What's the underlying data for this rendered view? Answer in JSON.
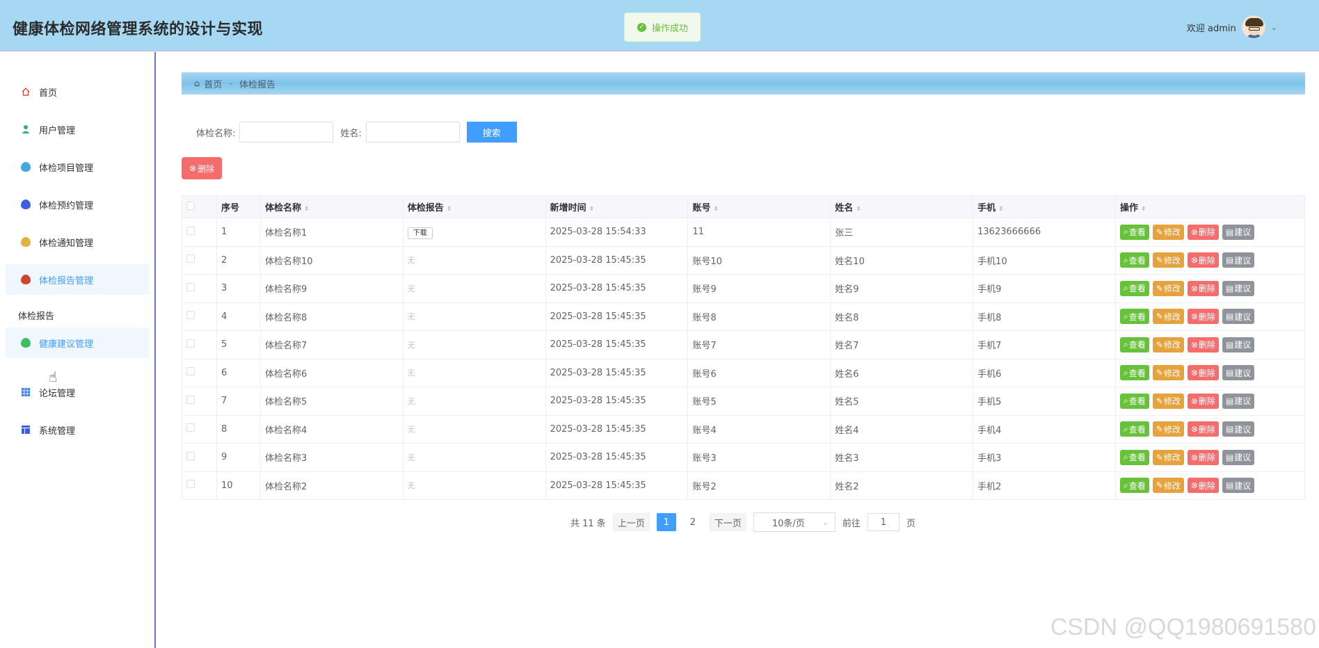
{
  "header": {
    "title": "健康体检网络管理系统的设计与实现",
    "toast": "操作成功",
    "welcome": "欢迎 admin"
  },
  "sidebar": {
    "items": [
      {
        "label": "首页",
        "icon": "home-icon",
        "color": "#e0473c"
      },
      {
        "label": "用户管理",
        "icon": "user-icon",
        "color": "#2fb36d"
      },
      {
        "label": "体检项目管理",
        "icon": "drop-icon",
        "color": "#3fa9e0"
      },
      {
        "label": "体检预约管理",
        "icon": "drop-icon",
        "color": "#3f5ee0"
      },
      {
        "label": "体检通知管理",
        "icon": "drop-icon",
        "color": "#e0b33f"
      },
      {
        "label": "体检报告管理",
        "icon": "drop-icon",
        "color": "#d0452f"
      },
      {
        "label": "健康建议管理",
        "icon": "drop-icon",
        "color": "#3ebf5f"
      },
      {
        "label": "论坛管理",
        "icon": "grid-icon",
        "color": "#3f7de0"
      },
      {
        "label": "系统管理",
        "icon": "layout-icon",
        "color": "#3f5ee0"
      }
    ],
    "group_title": "体检报告"
  },
  "breadcrumb": {
    "home": "首页",
    "sep": "-",
    "current": "体检报告"
  },
  "search": {
    "name_label": "体检名称:",
    "person_label": "姓名:",
    "button": "搜索"
  },
  "toolbar": {
    "delete": "删除"
  },
  "table": {
    "columns": [
      "序号",
      "体检名称",
      "体检报告",
      "新增时间",
      "账号",
      "姓名",
      "手机",
      "操作"
    ],
    "rows": [
      {
        "no": "1",
        "name": "体检名称1",
        "report": "下载",
        "time": "2025-03-28 15:54:33",
        "account": "11",
        "person": "张三",
        "phone": "13623666666"
      },
      {
        "no": "2",
        "name": "体检名称10",
        "report": "无",
        "time": "2025-03-28 15:45:35",
        "account": "账号10",
        "person": "姓名10",
        "phone": "手机10"
      },
      {
        "no": "3",
        "name": "体检名称9",
        "report": "无",
        "time": "2025-03-28 15:45:35",
        "account": "账号9",
        "person": "姓名9",
        "phone": "手机9"
      },
      {
        "no": "4",
        "name": "体检名称8",
        "report": "无",
        "time": "2025-03-28 15:45:35",
        "account": "账号8",
        "person": "姓名8",
        "phone": "手机8"
      },
      {
        "no": "5",
        "name": "体检名称7",
        "report": "无",
        "time": "2025-03-28 15:45:35",
        "account": "账号7",
        "person": "姓名7",
        "phone": "手机7"
      },
      {
        "no": "6",
        "name": "体检名称6",
        "report": "无",
        "time": "2025-03-28 15:45:35",
        "account": "账号6",
        "person": "姓名6",
        "phone": "手机6"
      },
      {
        "no": "7",
        "name": "体检名称5",
        "report": "无",
        "time": "2025-03-28 15:45:35",
        "account": "账号5",
        "person": "姓名5",
        "phone": "手机5"
      },
      {
        "no": "8",
        "name": "体检名称4",
        "report": "无",
        "time": "2025-03-28 15:45:35",
        "account": "账号4",
        "person": "姓名4",
        "phone": "手机4"
      },
      {
        "no": "9",
        "name": "体检名称3",
        "report": "无",
        "time": "2025-03-28 15:45:35",
        "account": "账号3",
        "person": "姓名3",
        "phone": "手机3"
      },
      {
        "no": "10",
        "name": "体检名称2",
        "report": "无",
        "time": "2025-03-28 15:45:35",
        "account": "账号2",
        "person": "姓名2",
        "phone": "手机2"
      }
    ],
    "ops": {
      "view": "查看",
      "edit": "修改",
      "delete": "删除",
      "advice": "建议"
    }
  },
  "pagination": {
    "total": "共 11 条",
    "prev": "上一页",
    "pages": [
      "1",
      "2"
    ],
    "next": "下一页",
    "size": "10条/页",
    "goto": "前往",
    "page_input": "1",
    "page_suffix": "页"
  },
  "watermark": "CSDN @QQ1980691580"
}
